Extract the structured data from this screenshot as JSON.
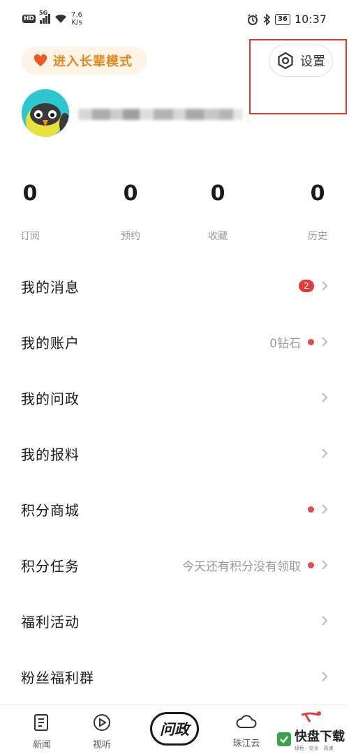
{
  "status_bar": {
    "hd": "HD",
    "network": "5G",
    "net_speed_value": "7.6",
    "net_speed_unit": "K/s",
    "battery": "36",
    "time": "10:37"
  },
  "header": {
    "elder_mode_label": "进入长辈模式",
    "settings_label": "设置"
  },
  "stats": [
    {
      "value": "0",
      "label": "订阅"
    },
    {
      "value": "0",
      "label": "预约"
    },
    {
      "value": "0",
      "label": "收藏"
    },
    {
      "value": "0",
      "label": "历史"
    }
  ],
  "menu": [
    {
      "label": "我的消息",
      "badge": "2"
    },
    {
      "label": "我的账户",
      "sub": "0钻石"
    },
    {
      "label": "我的问政"
    },
    {
      "label": "我的报料"
    },
    {
      "label": "积分商城"
    },
    {
      "label": "积分任务",
      "sub": "今天还有积分没有领取"
    },
    {
      "label": "福利活动"
    },
    {
      "label": "粉丝福利群"
    }
  ],
  "tabbar": {
    "news": "新闻",
    "video": "视听",
    "center": "问政",
    "cloud": "珠江云"
  },
  "watermark": {
    "main": "快盘下载",
    "sub": "绿色 · 安全 · 高速"
  },
  "colors": {
    "accent_orange": "#e08a1e",
    "badge_red": "#e23b3b",
    "highlight_red": "#d93a2a"
  }
}
